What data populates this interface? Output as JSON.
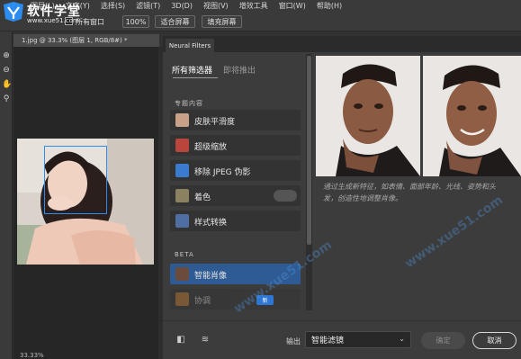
{
  "menu": {
    "items": [
      "图层(L)",
      "文字(Y)",
      "选择(S)",
      "滤镜(T)",
      "3D(D)",
      "视图(V)",
      "增效工具",
      "窗口(W)",
      "帮助(H)"
    ]
  },
  "logo": {
    "text": "软件学堂",
    "url": "www.xue51.com"
  },
  "options": {
    "checkbox_label": "所有窗口",
    "zoom_label": "100%",
    "fit_label": "适合屏幕",
    "fill_label": "填充屏幕"
  },
  "document": {
    "tab_label": "1.jpg @ 33.3% (图层 1, RGB/8#) *",
    "status": "33.33%"
  },
  "panel": {
    "title": "Neural Filters",
    "tabs": {
      "all": "所有筛选器",
      "coming": "即将推出"
    },
    "sections": {
      "featured": "专题内容",
      "beta": "BETA"
    },
    "featured_filters": [
      {
        "name": "皮肤平滑度"
      },
      {
        "name": "超级缩放"
      },
      {
        "name": "移除 JPEG 伪影"
      },
      {
        "name": "着色"
      },
      {
        "name": "样式转换"
      }
    ],
    "beta_filters": [
      {
        "name": "智能肖像"
      },
      {
        "name": "协调"
      }
    ],
    "new_badge": "新",
    "description": "通过生成新特征，如表情、面部年龄、光线、姿势和头发，创造性地调整肖像。",
    "output_label": "输出",
    "output_value": "智能滤镜",
    "ok_label": "确定",
    "cancel_label": "取消"
  },
  "colors": {
    "accent": "#2e5b94",
    "face_box": "#2d8cf0",
    "badge": "#2d76d6"
  }
}
